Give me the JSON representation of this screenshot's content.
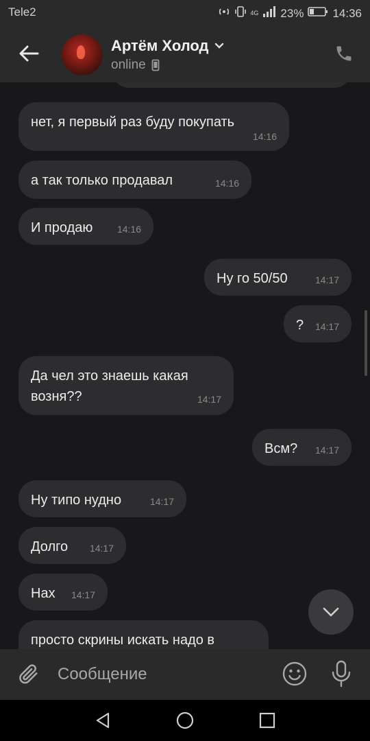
{
  "status_bar": {
    "carrier": "Tele2",
    "network": "4G",
    "battery": "23%",
    "time": "14:36",
    "icons": [
      "hotspot-icon",
      "vibrate-icon",
      "signal-icon",
      "battery-icon"
    ]
  },
  "header": {
    "contact_name": "Артём Холод",
    "status": "online",
    "icons": [
      "back-arrow-icon",
      "chevron-down-icon",
      "mobile-icon",
      "phone-icon"
    ]
  },
  "messages": [
    {
      "text": "",
      "time": "",
      "outgoing": true
    },
    {
      "text": "нет, я первый раз буду покупать",
      "time": "14:16",
      "outgoing": false
    },
    {
      "text": "а так только продавал",
      "time": "14:16",
      "outgoing": false
    },
    {
      "text": "И продаю",
      "time": "14:16",
      "outgoing": false
    },
    {
      "text": "Ну го 50/50",
      "time": "14:17",
      "outgoing": true
    },
    {
      "text": "?",
      "time": "14:17",
      "outgoing": true
    },
    {
      "text": "Да чел это знаешь какая возня??",
      "time": "14:17",
      "outgoing": false
    },
    {
      "text": "Всм?",
      "time": "14:17",
      "outgoing": true
    },
    {
      "text": "Ну типо нудно",
      "time": "14:17",
      "outgoing": false
    },
    {
      "text": "Долго",
      "time": "14:17",
      "outgoing": false
    },
    {
      "text": "Нах",
      "time": "14:17",
      "outgoing": false
    },
    {
      "text": "просто скрины искать надо в",
      "time": "",
      "outgoing": false
    }
  ],
  "composer": {
    "placeholder": "Сообщение",
    "icons": [
      "attach-icon",
      "emoji-icon",
      "microphone-icon"
    ]
  },
  "nav": {
    "icons": [
      "nav-back-icon",
      "nav-home-icon",
      "nav-recents-icon"
    ]
  },
  "colors": {
    "background": "#18181a",
    "bar": "#2a2a2a",
    "bubble": "#2d2d30",
    "text": "#ececec",
    "time": "#8a8a8a"
  }
}
